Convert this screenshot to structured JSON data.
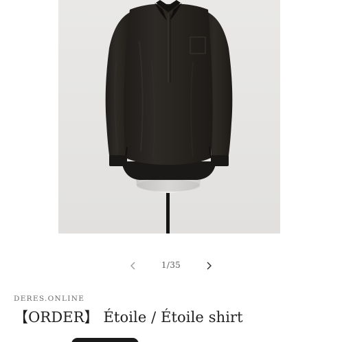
{
  "vendor": "DERES.ONLINE",
  "product": {
    "title": "【ORDER】 Étoile / Étoile shirt",
    "image": {
      "subject": "black long-sleeve shirt on dress form",
      "background_color": "#e6e5e3",
      "garment_color": "#26221f"
    }
  },
  "gallery": {
    "prev_icon": "chevron-left-icon",
    "next_icon": "chevron-right-icon",
    "counter": "1/35"
  },
  "colors": {
    "text_primary": "#1e1e1e",
    "text_secondary": "#6a6a6a",
    "arrow": "#9a9a9a",
    "button": "#1a1a1a"
  }
}
